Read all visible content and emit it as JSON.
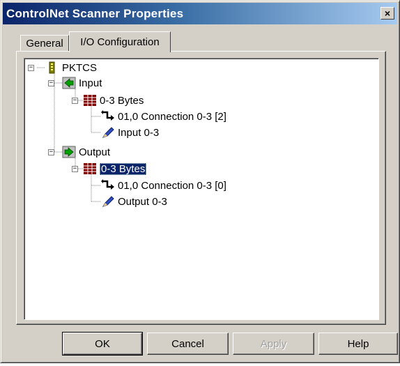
{
  "window": {
    "title": "ControlNet Scanner Properties",
    "close_label": "×"
  },
  "tabs": [
    {
      "label": "General",
      "active": false
    },
    {
      "label": "I/O Configuration",
      "active": true
    }
  ],
  "tree": {
    "root": {
      "label": "PKTCS",
      "expander": "−",
      "icon": "module-icon"
    },
    "input": {
      "label": "Input",
      "expander": "−",
      "icon": "input-arrow-icon"
    },
    "input_bytes": {
      "label": "0-3 Bytes",
      "expander": "−",
      "icon": "data-grid-icon"
    },
    "input_connection": {
      "label": "01,0 Connection 0-3 [2]",
      "icon": "connection-arrow-icon"
    },
    "input_tag": {
      "label": "Input 0-3",
      "icon": "pencil-tag-icon"
    },
    "output": {
      "label": "Output",
      "expander": "−",
      "icon": "output-arrow-icon"
    },
    "output_bytes": {
      "label": "0-3 Bytes",
      "expander": "−",
      "icon": "data-grid-icon",
      "selected": true
    },
    "output_connection": {
      "label": "01,0 Connection 0-3 [0]",
      "icon": "connection-arrow-icon"
    },
    "output_tag": {
      "label": "Output 0-3",
      "icon": "pencil-tag-icon"
    }
  },
  "buttons": {
    "ok": "OK",
    "cancel": "Cancel",
    "apply": "Apply",
    "help": "Help"
  },
  "colors": {
    "titlebar_start": "#0a246a",
    "titlebar_end": "#a6caf0",
    "dialog_face": "#d4d0c8",
    "selection": "#0a246a"
  }
}
